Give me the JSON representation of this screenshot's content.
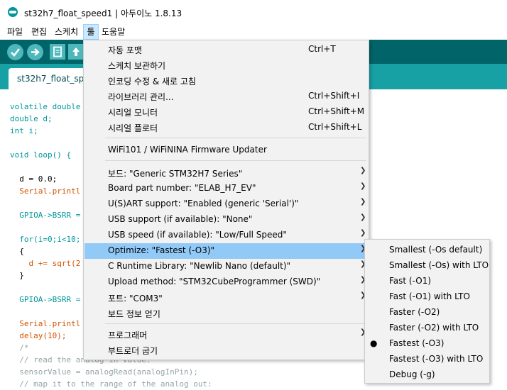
{
  "window": {
    "title": "st32h7_float_speed1 | 아두이노 1.8.13"
  },
  "menubar": {
    "items": [
      "파일",
      "편집",
      "스케치",
      "툴",
      "도움말"
    ],
    "active_index": 3
  },
  "toolbar": {
    "buttons": [
      "verify-icon",
      "upload-icon",
      "new-icon",
      "open-icon"
    ]
  },
  "tab": {
    "label": "st32h7_float_spe"
  },
  "code": {
    "lines": [
      "volatile double",
      "double d;",
      "int i;",
      "",
      "void loop() {",
      "",
      "  d = 0.0;",
      "  Serial.printl",
      "",
      "  GPIOA->BSRR =",
      "",
      "  for(i=0;i<10;",
      "  {",
      "    d += sqrt(2",
      "  }",
      "",
      "  GPIOA->BSRR =",
      "",
      "  Serial.printl",
      "  delay(10);",
      "  /*",
      "  // read the analog in value:",
      "  sensorValue = analogRead(analogInPin);",
      "  // map it to the range of the analog out:"
    ]
  },
  "tools_menu": {
    "items": [
      {
        "label": "자동 포맷",
        "shortcut": "Ctrl+T"
      },
      {
        "label": "스케치 보관하기",
        "shortcut": ""
      },
      {
        "label": "인코딩 수정 & 새로 고침",
        "shortcut": ""
      },
      {
        "label": "라이브러리 관리...",
        "shortcut": "Ctrl+Shift+I"
      },
      {
        "label": "시리얼 모니터",
        "shortcut": "Ctrl+Shift+M"
      },
      {
        "label": "시리얼 플로터",
        "shortcut": "Ctrl+Shift+L"
      },
      {
        "label": "WiFi101 / WiFiNINA Firmware Updater",
        "shortcut": ""
      },
      {
        "label": "보드: \"Generic STM32H7 Series\"",
        "shortcut": ""
      },
      {
        "label": "Board part number: \"ELAB_H7_EV\"",
        "shortcut": ""
      },
      {
        "label": "U(S)ART support: \"Enabled (generic 'Serial')\"",
        "shortcut": ""
      },
      {
        "label": "USB support (if available): \"None\"",
        "shortcut": ""
      },
      {
        "label": "USB speed (if available): \"Low/Full Speed\"",
        "shortcut": ""
      },
      {
        "label": "Optimize: \"Fastest (-O3)\"",
        "shortcut": ""
      },
      {
        "label": "C Runtime Library: \"Newlib Nano (default)\"",
        "shortcut": ""
      },
      {
        "label": "Upload method: \"STM32CubeProgrammer (SWD)\"",
        "shortcut": ""
      },
      {
        "label": "포트: \"COM3\"",
        "shortcut": ""
      },
      {
        "label": "보드 정보 얻기",
        "shortcut": ""
      },
      {
        "label": "프로그래머",
        "shortcut": ""
      },
      {
        "label": "부트로더 굽기",
        "shortcut": ""
      }
    ]
  },
  "optimize_submenu": {
    "items": [
      "Smallest (-Os default)",
      "Smallest (-Os) with LTO",
      "Fast (-O1)",
      "Fast (-O1) with LTO",
      "Faster (-O2)",
      "Faster (-O2) with LTO",
      "Fastest (-O3)",
      "Fastest (-O3) with LTO",
      "Debug (-g)"
    ],
    "selected_index": 6,
    "check_glyph": "●"
  },
  "colors": {
    "toolbar": "#006468",
    "tabbar": "#17a1a5",
    "highlight": "#91c9f7",
    "keyword": "#00979c",
    "function": "#d35400",
    "comment": "#95a5a6"
  }
}
